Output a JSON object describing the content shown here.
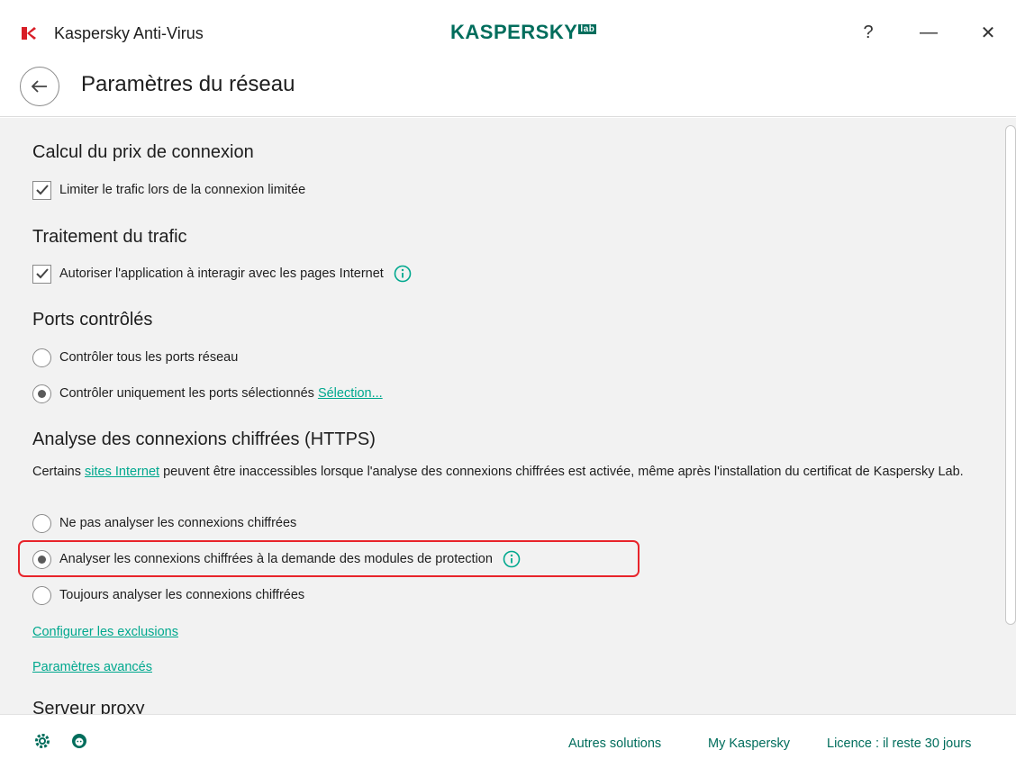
{
  "titlebar": {
    "app_title": "Kaspersky Anti-Virus",
    "brand": "KASPERSKY",
    "brand_badge": "lab",
    "help_label": "?",
    "minimize_label": "—",
    "close_label": "✕"
  },
  "header": {
    "back_label": "←",
    "page_title": "Paramètres du réseau"
  },
  "sections": {
    "connection_cost": {
      "title": "Calcul du prix de connexion",
      "limit_traffic": {
        "label": "Limiter le trafic lors de la connexion limitée",
        "checked": true
      }
    },
    "traffic": {
      "title": "Traitement du trafic",
      "allow_interaction": {
        "label": "Autoriser l'application à interagir avec les pages Internet",
        "checked": true
      }
    },
    "ports": {
      "title": "Ports contrôlés",
      "all_ports": {
        "label": "Contrôler tous les ports réseau",
        "selected": false
      },
      "selected_ports": {
        "label": "Contrôler uniquement les ports sélectionnés",
        "selected": true,
        "link": "Sélection..."
      }
    },
    "https": {
      "title": "Analyse des connexions chiffrées (HTTPS)",
      "desc_before": "Certains ",
      "desc_link": "sites Internet",
      "desc_after": " peuvent être inaccessibles lorsque l'analyse des connexions chiffrées est activée, même après l'installation du certificat de Kaspersky Lab.",
      "options": [
        {
          "label": "Ne pas analyser les connexions chiffrées",
          "selected": false
        },
        {
          "label": "Analyser les connexions chiffrées à la demande des modules de protection",
          "selected": true
        },
        {
          "label": "Toujours analyser les connexions chiffrées",
          "selected": false
        }
      ],
      "exclusions_link": "Configurer les exclusions",
      "advanced_link": "Paramètres avancés"
    },
    "proxy": {
      "title": "Serveur proxy"
    }
  },
  "footer": {
    "other_solutions": "Autres solutions",
    "my_kaspersky": "My Kaspersky",
    "license": "Licence : il reste 30 jours"
  },
  "colors": {
    "brand": "#006d5c",
    "link": "#00a88e",
    "highlight": "#e8242b",
    "content_bg": "#f2f2f2"
  }
}
